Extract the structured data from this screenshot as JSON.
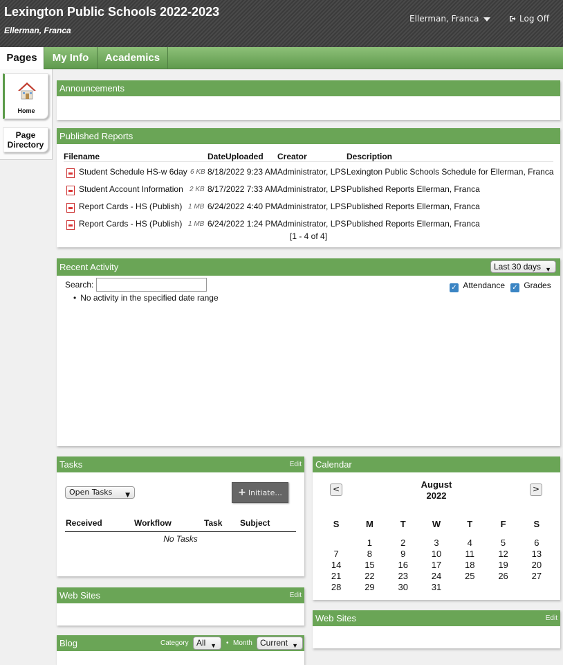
{
  "header": {
    "title": "Lexington Public Schools 2022-2023",
    "subtitle": "Ellerman, Franca",
    "user": "Ellerman, Franca",
    "logoff": "Log Off"
  },
  "tabs": [
    "Pages",
    "My Info",
    "Academics"
  ],
  "sidenav": {
    "home": "Home",
    "directory_line1": "Page",
    "directory_line2": "Directory"
  },
  "announcements": {
    "title": "Announcements"
  },
  "reports": {
    "title": "Published Reports",
    "columns": [
      "Filename",
      "DateUploaded",
      "Creator",
      "Description"
    ],
    "rows": [
      {
        "filename": "Student Schedule HS-w 6day",
        "size": "6 KB",
        "date": "8/18/2022 9:23 AM",
        "creator": "Administrator, LPS",
        "desc": "Lexington Public Schools Schedule for Ellerman, Franca"
      },
      {
        "filename": "Student Account Information",
        "size": "2 KB",
        "date": "8/17/2022 7:33 AM",
        "creator": "Administrator, LPS",
        "desc": "Published Reports Ellerman, Franca"
      },
      {
        "filename": "Report Cards - HS (Publish)",
        "size": "1 MB",
        "date": "6/24/2022 4:40 PM",
        "creator": "Administrator, LPS",
        "desc": "Published Reports Ellerman, Franca"
      },
      {
        "filename": "Report Cards - HS (Publish)",
        "size": "1 MB",
        "date": "6/24/2022 1:24 PM",
        "creator": "Administrator, LPS",
        "desc": "Published Reports Ellerman, Franca"
      }
    ],
    "pager": "[1 - 4 of 4]"
  },
  "activity": {
    "title": "Recent Activity",
    "range": "Last 30 days",
    "search_label": "Search:",
    "search_value": "",
    "attendance": "Attendance",
    "grades": "Grades",
    "empty": "No activity in the specified date range"
  },
  "tasks": {
    "title": "Tasks",
    "edit": "Edit",
    "filter": "Open Tasks",
    "initiate": "Initiate...",
    "columns": [
      "Received",
      "Workflow",
      "Task",
      "Subject"
    ],
    "empty": "No Tasks"
  },
  "websites_left": {
    "title": "Web Sites",
    "edit": "Edit"
  },
  "blog": {
    "title": "Blog",
    "category_label": "Category",
    "category_value": "All",
    "month_label": "Month",
    "month_value": "Current"
  },
  "calendar": {
    "title": "Calendar",
    "month": "August",
    "year": "2022",
    "prev": "<",
    "next": ">",
    "days": [
      "S",
      "M",
      "T",
      "W",
      "T",
      "F",
      "S"
    ],
    "weeks": [
      [
        "",
        "1",
        "2",
        "3",
        "4",
        "5",
        "6"
      ],
      [
        "7",
        "8",
        "9",
        "10",
        "11",
        "12",
        "13"
      ],
      [
        "14",
        "15",
        "16",
        "17",
        "18",
        "19",
        "20"
      ],
      [
        "21",
        "22",
        "23",
        "24",
        "25",
        "26",
        "27"
      ],
      [
        "28",
        "29",
        "30",
        "31",
        "",
        "",
        ""
      ]
    ]
  },
  "websites_right": {
    "title": "Web Sites",
    "edit": "Edit"
  }
}
